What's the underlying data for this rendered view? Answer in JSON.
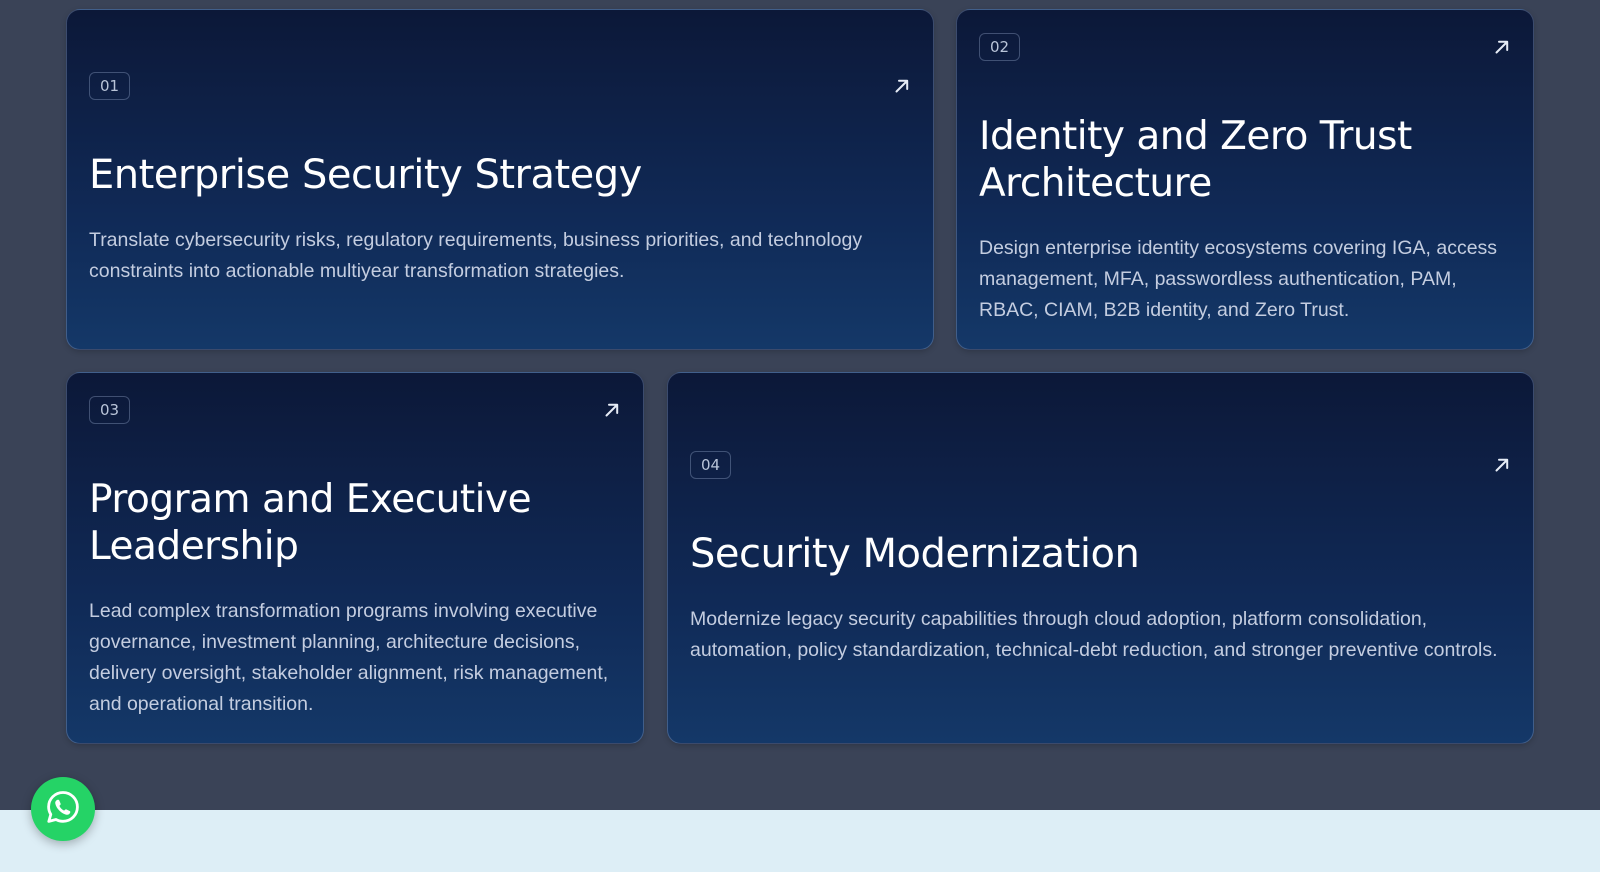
{
  "cards": [
    {
      "number": "01",
      "title": "Enterprise Security Strategy",
      "description": "Translate cybersecurity risks, regulatory requirements, business priorities, and technology constraints into actionable multiyear transformation strategies.",
      "icon": "arrow-up-right-icon"
    },
    {
      "number": "02",
      "title": "Identity and Zero Trust Architecture",
      "description": "Design enterprise identity ecosystems covering IGA, access management, MFA, passwordless authentication, PAM, RBAC, CIAM, B2B identity, and Zero Trust.",
      "icon": "arrow-up-right-icon"
    },
    {
      "number": "03",
      "title": "Program and Executive Leadership",
      "description": "Lead complex transformation programs involving executive governance, investment planning, architecture decisions, delivery oversight, stakeholder alignment, risk management, and operational transition.",
      "icon": "arrow-up-right-icon"
    },
    {
      "number": "04",
      "title": "Security Modernization",
      "description": "Modernize legacy security capabilities through cloud adoption, platform consolidation, automation, policy standardization, technical-debt reduction, and stronger preventive controls.",
      "icon": "arrow-up-right-icon"
    }
  ],
  "floating_button": {
    "icon": "whatsapp-icon",
    "color": "#25d366"
  },
  "colors": {
    "page_background": "#3a4357",
    "card_gradient_top": "#0c1838",
    "card_gradient_bottom": "#143868",
    "footer_band": "#ddeef6"
  }
}
